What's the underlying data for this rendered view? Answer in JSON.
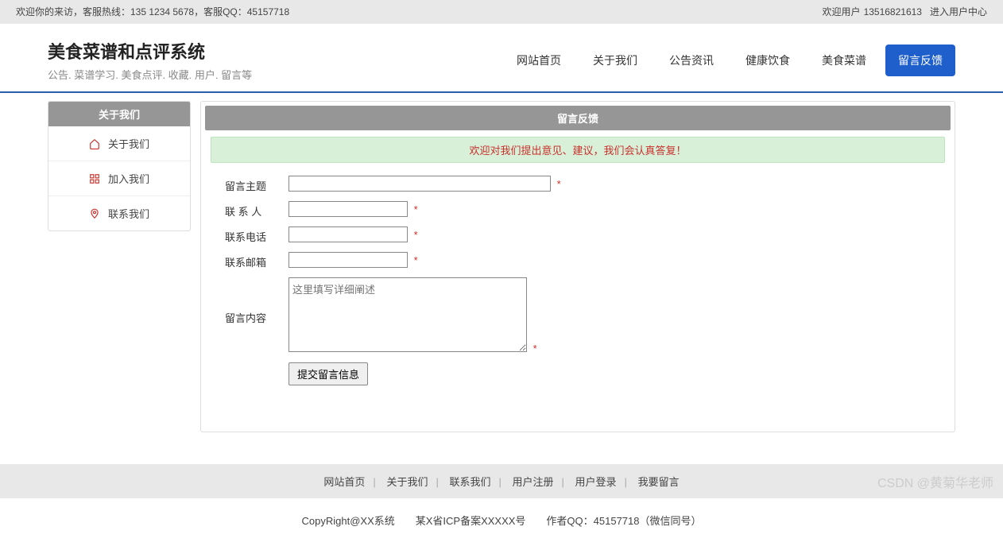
{
  "topbar": {
    "welcome": "欢迎你的来访，客服热线：135 1234 5678，客服QQ：45157718",
    "user_prefix": "欢迎用户",
    "username": "13516821613",
    "user_center": "进入用户中心"
  },
  "header": {
    "title": "美食菜谱和点评系统",
    "subtitle": "公告. 菜谱学习. 美食点评. 收藏. 用户. 留言等"
  },
  "nav": {
    "items": [
      {
        "label": "网站首页"
      },
      {
        "label": "关于我们"
      },
      {
        "label": "公告资讯"
      },
      {
        "label": "健康饮食"
      },
      {
        "label": "美食菜谱"
      },
      {
        "label": "留言反馈"
      }
    ]
  },
  "sidebar": {
    "title": "关于我们",
    "items": [
      {
        "label": "关于我们",
        "icon": "home-icon"
      },
      {
        "label": "加入我们",
        "icon": "grid-icon"
      },
      {
        "label": "联系我们",
        "icon": "pin-icon"
      }
    ]
  },
  "main": {
    "title": "留言反馈",
    "notice": "欢迎对我们提出意见、建议，我们会认真答复！",
    "form": {
      "subject_label": "留言主题",
      "contact_label": "联 系 人",
      "phone_label": "联系电话",
      "email_label": "联系邮箱",
      "content_label": "留言内容",
      "content_placeholder": "这里填写详细阐述",
      "submit_label": "提交留言信息",
      "required_mark": "*"
    }
  },
  "footer": {
    "links": [
      "网站首页",
      "关于我们",
      "联系我们",
      "用户注册",
      "用户登录",
      "我要留言"
    ],
    "copyright": "CopyRight@XX系统　　某X省ICP备案XXXXX号　　作者QQ：45157718（微信同号）"
  },
  "watermark": "CSDN @黄菊华老师"
}
